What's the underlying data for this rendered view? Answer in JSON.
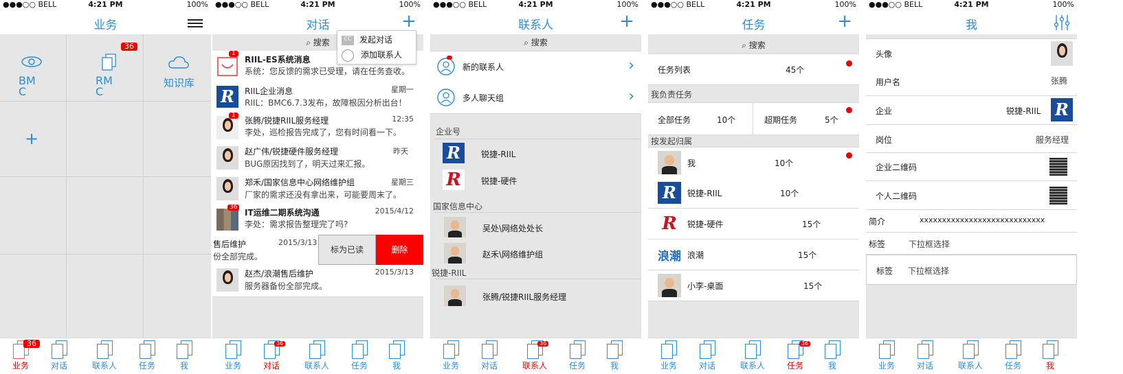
{
  "status": {
    "carrier": "●●●○○ BELL",
    "time": "4:21 PM",
    "battery": "100%"
  },
  "tabs": [
    "业务",
    "对话",
    "联系人",
    "任务",
    "我"
  ],
  "tab_badge": "36",
  "s1": {
    "title": "业务",
    "tiles": [
      {
        "label": "BM C",
        "icon": "eye-icon"
      },
      {
        "label": "RM C",
        "icon": "documents-icon",
        "badge": "36"
      },
      {
        "label": "知识库",
        "icon": "cloud-icon"
      }
    ],
    "add": "+"
  },
  "s2": {
    "title": "对话",
    "search": "搜索",
    "menu": [
      "发起对话",
      "添加联系人"
    ],
    "items": [
      {
        "name": "RIIL-ES系统消息",
        "msg": "系统：您反馈的需求已受理，请在任务查收。",
        "time": "",
        "badge": "1"
      },
      {
        "name": "RIIL企业消息",
        "msg": "RIIL：BMC6.7.3发布，故障根因分析出台！",
        "time": "星期一",
        "badge": ""
      },
      {
        "name": "张腾/锐捷RIIL服务经理",
        "msg": "李处，巡检报告完成了，您有时间看一下。",
        "time": "12:35",
        "badge": "1"
      },
      {
        "name": "赵广伟/锐捷硬件服务经理",
        "msg": "BUG原因找到了，明天过来汇报。",
        "time": "昨天",
        "badge": ""
      },
      {
        "name": "郑禾/国家信息中心网络维护组",
        "msg": "厂家的需求还没有拿出来，可能要周末了。",
        "time": "星期三",
        "badge": ""
      },
      {
        "name": "IT运维二期系统沟通",
        "msg": "李处：需求报告整理完了吗?",
        "time": "2015/4/12",
        "badge": "36"
      },
      {
        "name": "售后维护",
        "msg": "份全部完成。",
        "time": "2015/3/13",
        "badge": ""
      },
      {
        "name": "赵杰/浪潮售后维护",
        "msg": "服务器备份全部完成。",
        "time": "2015/3/13",
        "badge": ""
      }
    ],
    "mark_read": "标为已读",
    "delete": "删除"
  },
  "s3": {
    "title": "联系人",
    "search": "搜索",
    "new_contacts": "新的联系人",
    "group_chat": "多人聊天组",
    "sec_enterprise": "企业号",
    "enterprise": [
      "锐捷-RIIL",
      "锐捷-硬件"
    ],
    "sec_center": "国家信息中心",
    "center": [
      "吴处\\网络处处长",
      "赵禾\\网络维护组"
    ],
    "sec_riil": "锐捷-RIIL",
    "riil": [
      "张腾/锐捷RIIL服务经理"
    ]
  },
  "s4": {
    "title": "任务",
    "search": "搜索",
    "task_list": "任务列表",
    "task_list_count": "45个",
    "sec_mine": "我负责任务",
    "all_tasks": "全部任务",
    "all_count": "10个",
    "overdue": "超期任务",
    "overdue_count": "5个",
    "sec_owner": "按发起归属",
    "owners": [
      {
        "name": "我",
        "count": "10个"
      },
      {
        "name": "锐捷-RIIL",
        "count": "10个"
      },
      {
        "name": "锐捷-硬件",
        "count": "15个"
      },
      {
        "name": "浪潮",
        "count": "15个"
      },
      {
        "name": "小李-桌面",
        "count": "15个"
      }
    ],
    "inspur_logo": "浪潮"
  },
  "s5": {
    "title": "我",
    "rows": [
      {
        "label": "头像",
        "value": ""
      },
      {
        "label": "用户名",
        "value": "张腾"
      },
      {
        "label": "企业",
        "value": "锐捷-RIIL"
      },
      {
        "label": "岗位",
        "value": "服务经理"
      },
      {
        "label": "企业二维码",
        "value": ""
      },
      {
        "label": "个人二维码",
        "value": ""
      },
      {
        "label": "简介",
        "value": "xxxxxxxxxxxxxxxxxxxxxxxxxxxx"
      },
      {
        "label": "标签",
        "value": "下拉框选择"
      },
      {
        "label": "标签",
        "value": "下拉框选择"
      }
    ]
  },
  "colors": {
    "accent": "#2b8ddb",
    "alert": "#e00000",
    "brand_blue": "#1a4d99"
  }
}
